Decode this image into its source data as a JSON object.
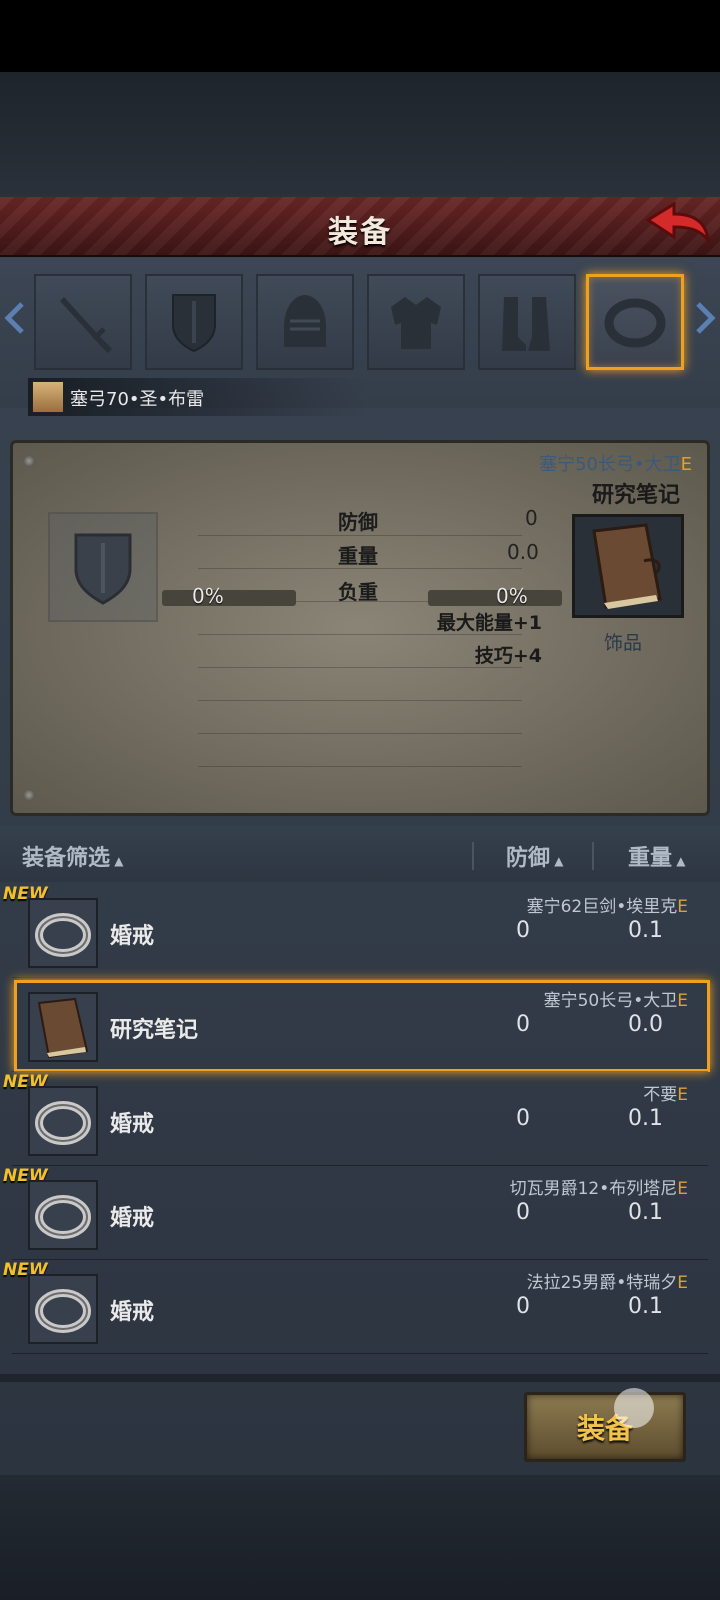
{
  "header": {
    "title": "装备"
  },
  "hero": {
    "name": "塞弓70•圣•布雷"
  },
  "slots": [
    "sword-icon",
    "shield-icon",
    "helmet-icon",
    "armor-icon",
    "boots-icon",
    "ring-icon"
  ],
  "compare": {
    "owner": "塞宁50长弓•大卫",
    "owner_suffix": "E",
    "item_name": "研究笔记",
    "category": "饰品",
    "stats": [
      {
        "label": "防御",
        "value": "0"
      },
      {
        "label": "重量",
        "value": "0.0"
      }
    ],
    "load_label": "负重",
    "load_left": "0%",
    "load_right": "0%",
    "bonuses": [
      "最大能量+1",
      "技巧+4"
    ]
  },
  "list_header": {
    "filter": "装备筛选",
    "defense": "防御",
    "weight": "重量"
  },
  "items": [
    {
      "new": "NEW",
      "name": "婚戒",
      "owner": "塞宁62巨剑•埃里克",
      "suffix": "E",
      "defense": "0",
      "weight": "0.1",
      "icon": "ring-icon"
    },
    {
      "new": "",
      "name": "研究笔记",
      "owner": "塞宁50长弓•大卫",
      "suffix": "E",
      "defense": "0",
      "weight": "0.0",
      "icon": "book-icon"
    },
    {
      "new": "NEW",
      "name": "婚戒",
      "owner": "不要",
      "suffix": "E",
      "defense": "0",
      "weight": "0.1",
      "icon": "ring-icon"
    },
    {
      "new": "NEW",
      "name": "婚戒",
      "owner": "切瓦男爵12•布列塔尼",
      "suffix": "E",
      "defense": "0",
      "weight": "0.1",
      "icon": "ring-icon"
    },
    {
      "new": "NEW",
      "name": "婚戒",
      "owner": "法拉25男爵•特瑞夕",
      "suffix": "E",
      "defense": "0",
      "weight": "0.1",
      "icon": "ring-icon"
    }
  ],
  "equip_button": "装备",
  "colors": {
    "accent": "#f0a020",
    "header": "#6b2626",
    "new_badge": "#f2c02a"
  }
}
